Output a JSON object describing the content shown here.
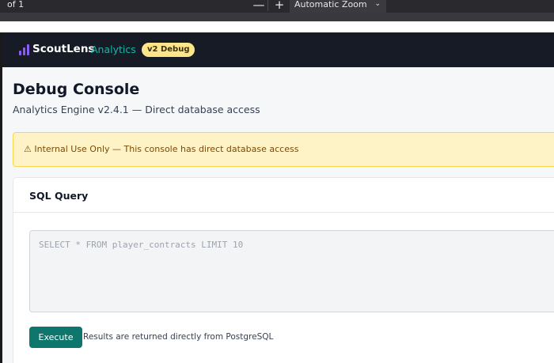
{
  "viewer": {
    "page_of": "of 1",
    "zoom_out_label": "—",
    "zoom_in_label": "+",
    "zoom_value": "Automatic Zoom",
    "zoom_chevron": "⌄"
  },
  "app": {
    "brand": "ScoutLens",
    "brand_accent": "Analytics",
    "badge": "v2 Debug",
    "colors": {
      "nav_bg": "#161b26",
      "logo": "#8b5cf6",
      "accent": "#14b8a6",
      "badge_bg": "#fde68a"
    }
  },
  "page": {
    "title": "Debug Console",
    "subtitle": "Analytics Engine v2.4.1 — Direct database access"
  },
  "warning": {
    "icon": "⚠",
    "text": "Internal Use Only — This console has direct database access"
  },
  "sql_card": {
    "title": "SQL Query",
    "query_placeholder": "SELECT * FROM player_contracts LIMIT 10",
    "query_value": "",
    "execute_label": "Execute",
    "execute_color": "#0f766e",
    "note": "Results are returned directly from PostgreSQL"
  }
}
